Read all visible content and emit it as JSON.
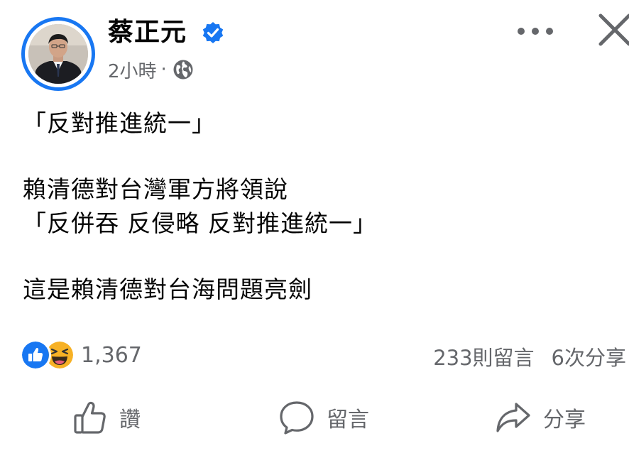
{
  "header": {
    "author_name": "蔡正元",
    "verified": true,
    "time": "2小時",
    "meta_separator": "·",
    "audience_icon": "globe-icon",
    "more_icon": "more-horizontal-icon",
    "close_icon": "close-icon"
  },
  "post": {
    "paragraphs": [
      [
        "「反對推進統一」"
      ],
      [
        "賴清德對台灣軍方將領說",
        "「反併吞 反侵略 反對推進統一」"
      ],
      [
        "這是賴清德對台海問題亮劍"
      ]
    ]
  },
  "stats": {
    "reaction_icons": [
      "like-reaction-icon",
      "haha-reaction-icon"
    ],
    "reaction_count": "1,367",
    "comments": "233則留言",
    "shares": "6次分享"
  },
  "actions": {
    "like_label": "讚",
    "comment_label": "留言",
    "share_label": "分享"
  },
  "colors": {
    "brand_blue": "#1877f2",
    "secondary_text": "#65676b",
    "primary_text": "#050505",
    "haha_yellow": "#f7b125"
  }
}
